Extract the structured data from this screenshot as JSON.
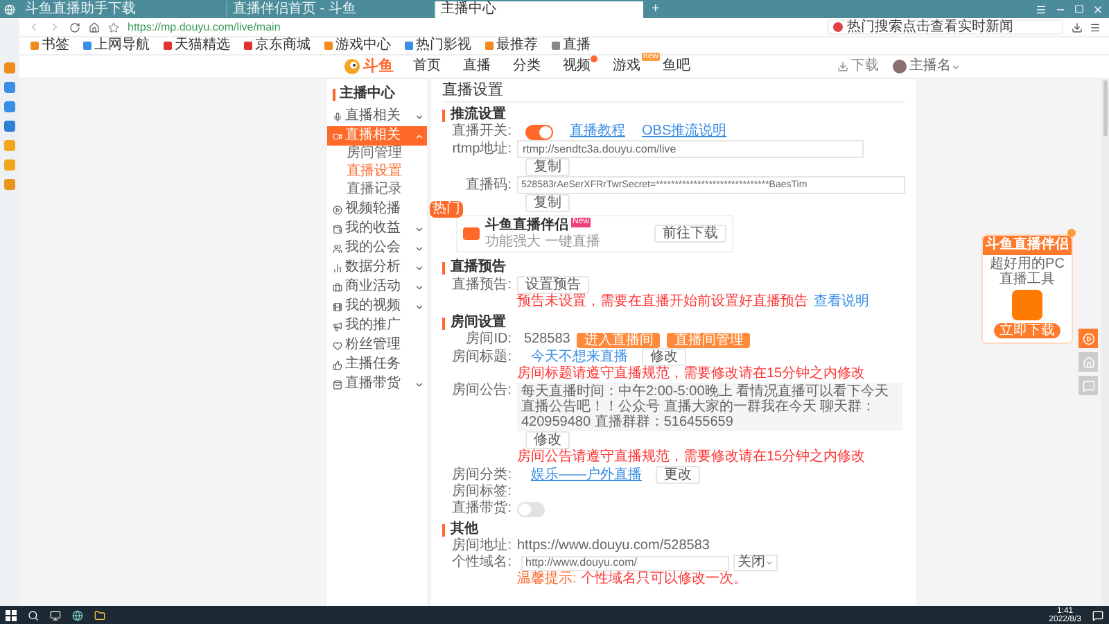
{
  "browser": {
    "tabs": [
      {
        "title": "斗鱼直播助手下载",
        "selected": false
      },
      {
        "title": "直播伴侣首页 - 斗鱼",
        "selected": false
      },
      {
        "title": "主播中心",
        "selected": true
      }
    ],
    "new_tab": "+",
    "url": "https://mp.douyu.com/live/main",
    "search_placeholder": "热门搜索点击查看实时新闻",
    "bookmarks": [
      "书签",
      "上网导航",
      "天猫精选",
      "京东商城",
      "游戏中心",
      "热门影视",
      "最推荐",
      "直播"
    ]
  },
  "site_header": {
    "logo": "斗鱼",
    "nav": [
      {
        "label": "首页",
        "hot": false
      },
      {
        "label": "直播",
        "hot": false
      },
      {
        "label": "分类",
        "hot": false
      },
      {
        "label": "视频",
        "hot": true
      },
      {
        "label": "游戏",
        "hot": false,
        "badge": "new"
      },
      {
        "label": "鱼吧",
        "hot": false
      }
    ],
    "download": "下载",
    "user": "主播名"
  },
  "sidebar": {
    "title": "主播中心",
    "items": [
      {
        "label": "直播相关",
        "selected": false,
        "expanded": false
      },
      {
        "label": "直播相关",
        "selected": true,
        "expanded": true,
        "children": [
          {
            "label": "房间管理",
            "selected": false
          },
          {
            "label": "直播设置",
            "selected": true
          },
          {
            "label": "直播记录",
            "selected": false
          }
        ]
      },
      {
        "label": "视频轮播",
        "selected": false,
        "badge": "热门"
      },
      {
        "label": "我的收益",
        "selected": false,
        "expanded": false
      },
      {
        "label": "我的公会",
        "selected": false,
        "expanded": false
      },
      {
        "label": "数据分析",
        "selected": false,
        "expanded": false
      },
      {
        "label": "商业活动",
        "selected": false,
        "expanded": false
      },
      {
        "label": "我的视频",
        "selected": false,
        "expanded": false
      },
      {
        "label": "我的推广",
        "selected": false
      },
      {
        "label": "粉丝管理",
        "selected": false
      },
      {
        "label": "主播任务",
        "selected": false
      },
      {
        "label": "直播带货",
        "selected": false,
        "expanded": false
      }
    ]
  },
  "page_title": "直播设置",
  "stream": {
    "heading": "推流设置",
    "switch": {
      "label": "直播开关:",
      "on": true
    },
    "links": [
      "直播教程",
      "OBS推流说明"
    ],
    "rtmp": {
      "label": "rtmp地址:",
      "value": "rtmp://sendtc3a.douyu.com/live",
      "copy": "复制"
    },
    "code": {
      "label": "直播码:",
      "value": "528583rAeSerXFRrTwrSecret=******************************BaesTim",
      "copy": "复制"
    },
    "promo": {
      "title": "斗鱼直播伴侣",
      "badge": "New",
      "subtitle": "功能强大 一键直播",
      "button": "前往下载"
    }
  },
  "notice": {
    "heading": "直播预告",
    "label": "直播预告:",
    "button": "设置预告",
    "warning": "预告未设置，需要在直播开始前设置好直播预告",
    "link": "查看说明"
  },
  "room": {
    "heading": "房间设置",
    "id": {
      "label": "房间ID:",
      "value": "528583",
      "buttons": [
        "进入直播间",
        "直播间管理"
      ]
    },
    "title": {
      "label": "房间标题:",
      "value": "今天不想来直播",
      "button": "修改",
      "warning": "房间标题请遵守直播规范，需要修改请在15分钟之内修改"
    },
    "announcement": {
      "label": "房间公告:",
      "value": "每天直播时间：中午2:00-5:00晚上 看情况直播可以看下今天直播公告吧！！公众号 直播大家的一群我在今天 聊天群：420959480 直播群群：516455659",
      "button": "修改",
      "warning": "房间公告请遵守直播规范，需要修改请在15分钟之内修改"
    },
    "category": {
      "label": "房间分类:",
      "value": "娱乐——户外直播",
      "button": "更改"
    },
    "tags": {
      "label": "房间标签:"
    },
    "commerce": {
      "label": "直播带货:",
      "on": false
    }
  },
  "other": {
    "heading": "其他",
    "address": {
      "label": "房间地址:",
      "value": "https://www.douyu.com/528583"
    },
    "domain": {
      "label": "个性域名:",
      "prefix": "http://www.douyu.com/",
      "select": "关闭",
      "hint_label": "温馨提示:",
      "hint": "个性域名只可以修改一次。"
    }
  },
  "promo_card": {
    "title": "斗鱼直播伴侣",
    "subtitle": "超好用的PC直播工具",
    "button": "立即下载"
  },
  "taskbar": {
    "time": "1:41",
    "date": "2022/8/3"
  }
}
